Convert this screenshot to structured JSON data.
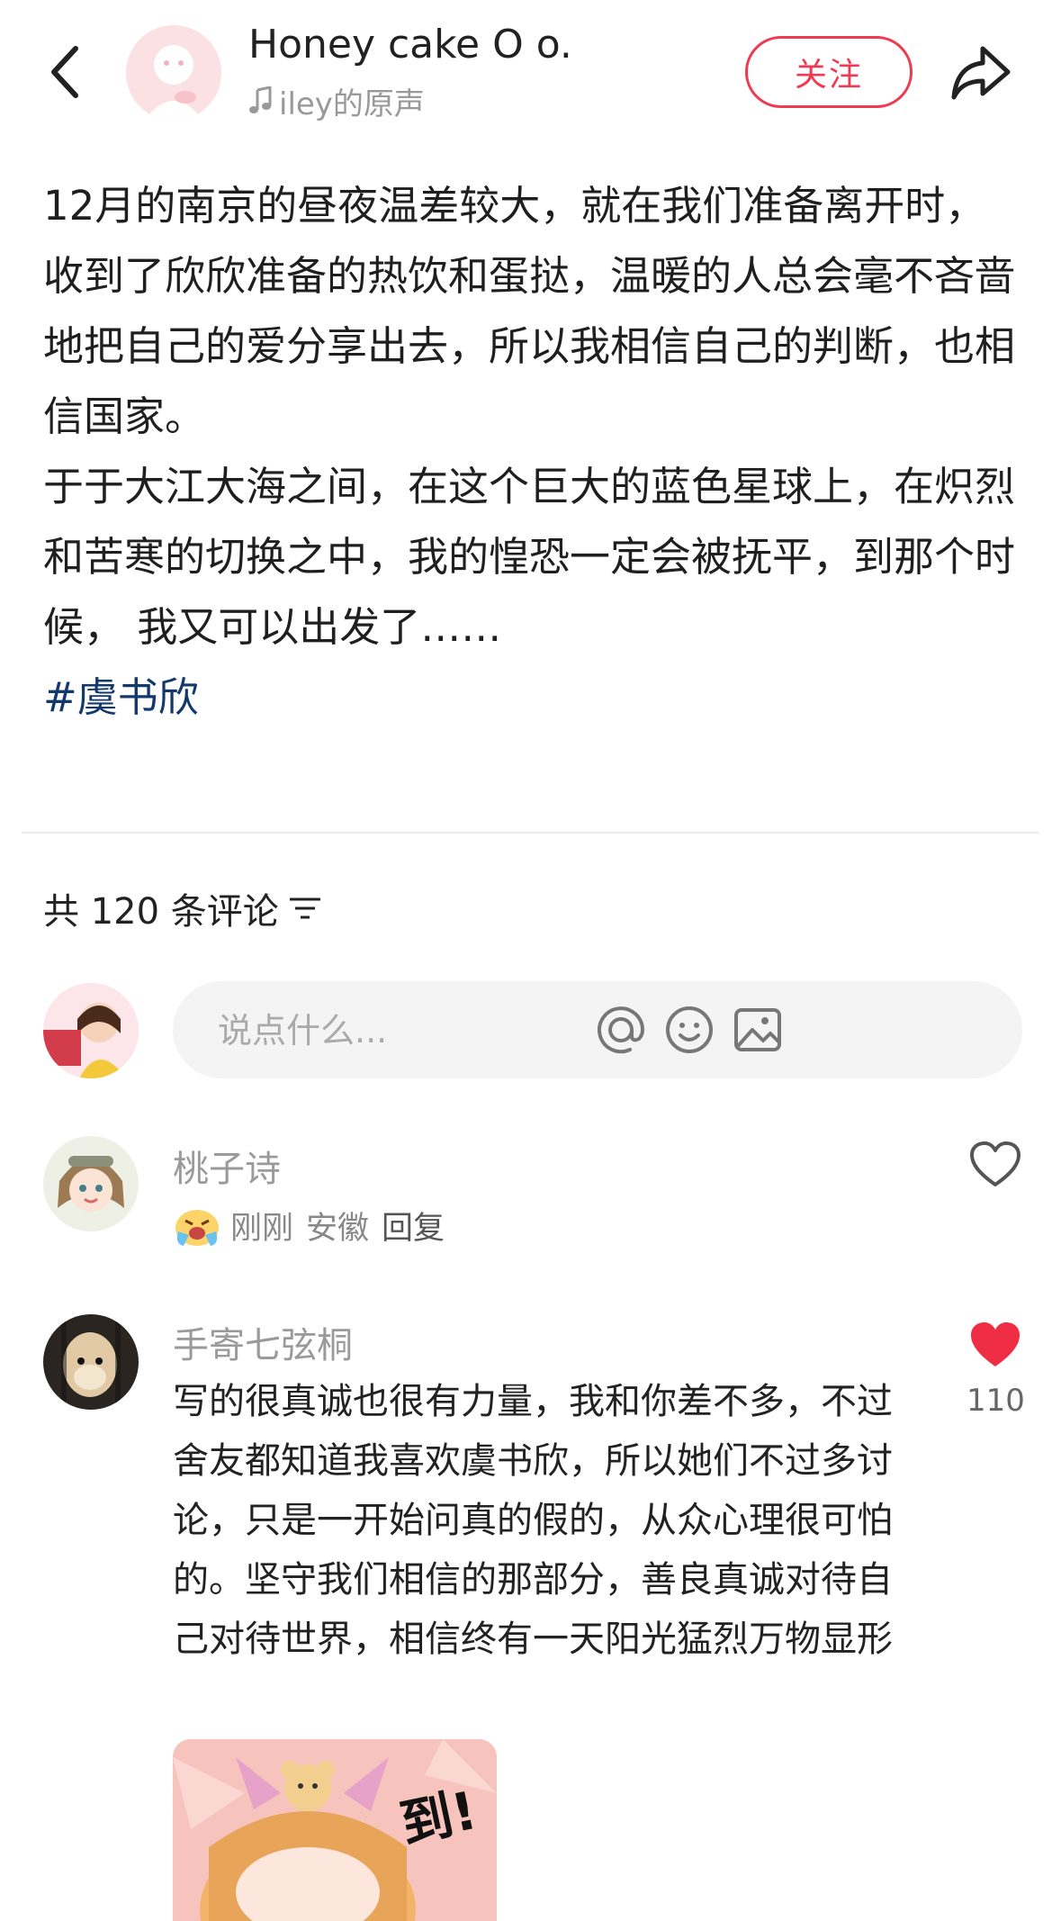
{
  "header": {
    "author_name": "Honey cake O o.",
    "music_label": "iley的原声",
    "follow_label": "关注"
  },
  "post": {
    "paragraph_1": "12月的南京的昼夜温差较大，就在我们准备离开时，收到了欣欣准备的热饮和蛋挞，温暖的人总会毫不吝啬地把自己的爱分享出去，所以我相信自己的判断，也相信国家。",
    "paragraph_2": "于于大江大海之间，在这个巨大的蓝色星球上，在炽烈和苦寒的切换之中，我的惶恐一定会被抚平，到那个时候， 我又可以出发了……",
    "hashtag": "#虞书欣"
  },
  "comments_header": {
    "count_label": "共 120 条评论"
  },
  "comment_input": {
    "placeholder": "说点什么..."
  },
  "comments": [
    {
      "user": "桃子诗",
      "time": "刚刚",
      "location": "安徽",
      "reply": "回复",
      "text": "",
      "likes": ""
    },
    {
      "user": "手寄七弦桐",
      "text": "写的很真诚也很有力量，我和你差不多，不过舍友都知道我喜欢虞书欣，所以她们不过多讨论，只是一开始问真的假的，从众心理很可怕的。坚守我们相信的那部分，善良真诚对待自己对待世界，相信终有一天阳光猛烈万物显形",
      "likes": "110",
      "sticker_text": "到!"
    }
  ],
  "colors": {
    "accent": "#ef3a52",
    "hashtag": "#13386c",
    "like_active": "#ef2d45"
  }
}
